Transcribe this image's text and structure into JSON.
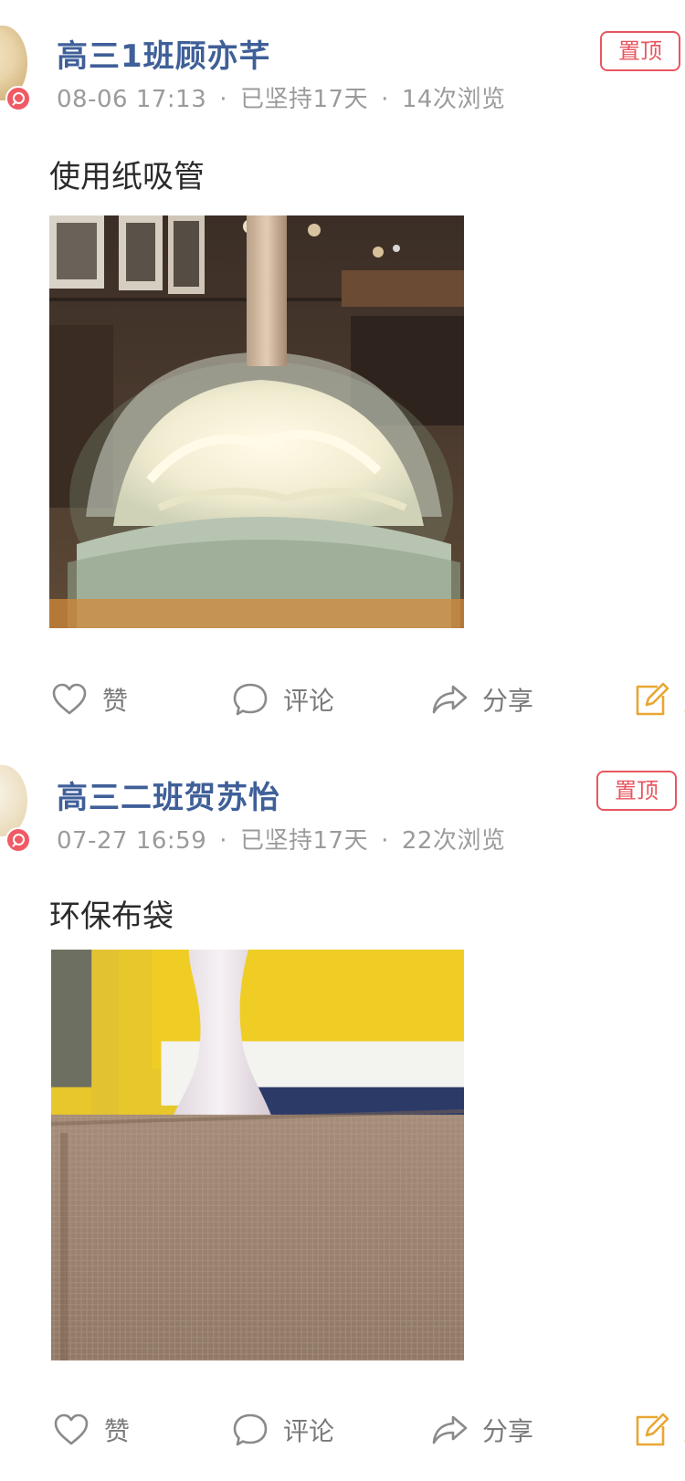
{
  "posts": [
    {
      "author": "高三1班顾亦芊",
      "date": "08-06 17:13",
      "streak": "已坚持17天",
      "views": "14次浏览",
      "pin_label": "置顶",
      "text": "使用纸吸管",
      "photo_subject": "straw-cup-photo"
    },
    {
      "author": "高三二班贺苏怡",
      "date": "07-27 16:59",
      "streak": "已坚持17天",
      "views": "22次浏览",
      "pin_label": "置顶",
      "text": "环保布袋",
      "photo_subject": "cloth-bag-photo"
    }
  ],
  "actions": {
    "like_label": "赞",
    "comment_label": "评论",
    "share_label": "分享",
    "edit_label": "点"
  },
  "meta_separator": "·",
  "colors": {
    "username": "#3f5f98",
    "meta": "#9b9b9b",
    "pin": "#e8565f",
    "action": "#7a7a7a",
    "edit_accent": "#e8a731",
    "badge": "#f05a64"
  }
}
